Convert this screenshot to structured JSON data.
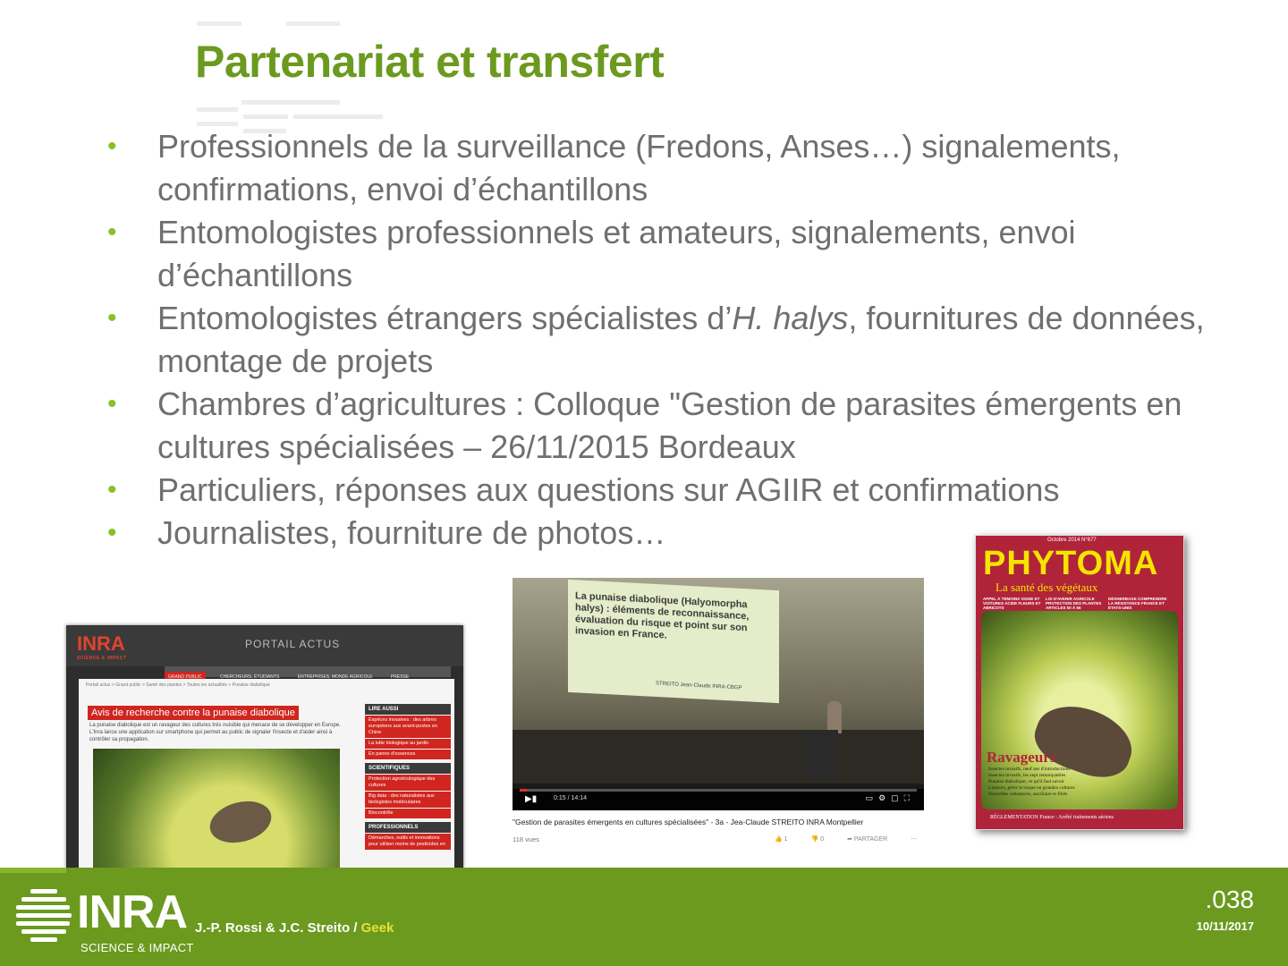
{
  "slide": {
    "title": "Partenariat et transfert",
    "bullets": [
      {
        "text": "Professionnels de la surveillance (Fredons, Anses…) signalements, confirmations, envoi d’échantillons"
      },
      {
        "text": "Entomologistes professionnels et amateurs, signalements, envoi d’échantillons"
      },
      {
        "pre": "Entomologistes étrangers spécialistes d’",
        "em": "H. halys",
        "post": ", fournitures de données, montage de projets"
      },
      {
        "text": "Chambres d’agricultures : Colloque \"Gestion de parasites émergents en cultures spécialisées – 26/11/2015 Bordeaux"
      },
      {
        "text": "Particuliers, réponses aux questions sur AGIIR et confirmations"
      },
      {
        "text": "Journalistes, fourniture de photos…"
      }
    ],
    "bullet_glyph": "•",
    "accent_color": "#6b9a1f"
  },
  "inra_portal": {
    "logo": "INRA",
    "logo_sub": "SCIENCE & IMPACT",
    "portal_title": "PORTAIL ACTUS",
    "nav": [
      "GRAND PUBLIC",
      "CHERCHEURS, ÉTUDIANTS",
      "ENTREPRISES, MONDE AGRICOLE",
      "PRESSE"
    ],
    "breadcrumb": "Portail actus > Grand public > Santé des plantes > Toutes les actualités > Punaise diabolique",
    "heading": "Avis de recherche contre la punaise diabolique",
    "intro": "La punaise diabolique est un ravageur des cultures très nuisible qui menace de se développer en Europe. L'Inra lance une application sur smartphone qui permet au public de signaler l'insecte et d'aider ainsi à contrôler sa propagation.",
    "sidebar": [
      {
        "header": "LIRE AUSSI",
        "items": [
          "Espèces invasives : des arbres européens aux avant-postes en Chine",
          "La lutte biologique au jardin",
          "En panne d'essences"
        ]
      },
      {
        "header": "SCIENTIFIQUES",
        "items": [
          "Protection agroécologique des cultures",
          "Big data : des naturalistes aux biologistes moléculaires",
          "Biocontrôle"
        ]
      },
      {
        "header": "PROFESSIONNELS",
        "items": [
          "Démarches, outils et innovations pour utiliser moins de pesticides en"
        ]
      }
    ]
  },
  "video": {
    "slide_title": "La punaise diabolique (Halyomorpha halys) : éléments de reconnaissance, évaluation du risque et point sur son invasion en France.",
    "slide_author": "STREITO Jean-Claude INRA-CBGP",
    "time": "0:15 / 14:14",
    "play_icon": "▶▮",
    "progress_fraction": 0.018,
    "caption": "\"Gestion de parasites émergents en cultures spécialisées\" - 3a - Jea-Claude STREITO INRA Montpellier",
    "views": "118 vues",
    "likes": "1",
    "dislikes": "0",
    "share": "PARTAGER",
    "more": "⋯"
  },
  "phytoma": {
    "issue": "Octobre 2014 N°677",
    "masthead": "PHYTOMA",
    "subtitle": "La santé des végétaux",
    "teasers": [
      "APPEL À TÉMOINS VIGNE ET VOITURES ACIDE FLEURS ET ABRICOTS",
      "LOI D'AVENIR AGRICOLE PROTECTION DES PLANTES ARTICLES 50 À 56",
      "DÉSHERBAGE COMPRENDRE LA RÉSISTANCE FRANCE ET ÉTATS-UNIS"
    ],
    "feature": "Ravageurs",
    "feature_items": [
      "Insectes invasifs, neuf ans d'introductions",
      "Insectes invasifs, les sept remarquables",
      "Punaise diabolique, ce qu'il faut savoir",
      "Limaces, gérer le risque en grandes cultures",
      "Nouvelles substances, auxiliaire et filets"
    ],
    "regulation": "RÉGLEMENTATION France : Arrêté traitements aériens"
  },
  "footer": {
    "logo": "INRA",
    "tagline": "SCIENCE & IMPACT",
    "authors": "J.-P. Rossi & J.C. Streito / ",
    "tag": "Geek",
    "page": ".038",
    "date": "10/11/2017"
  }
}
